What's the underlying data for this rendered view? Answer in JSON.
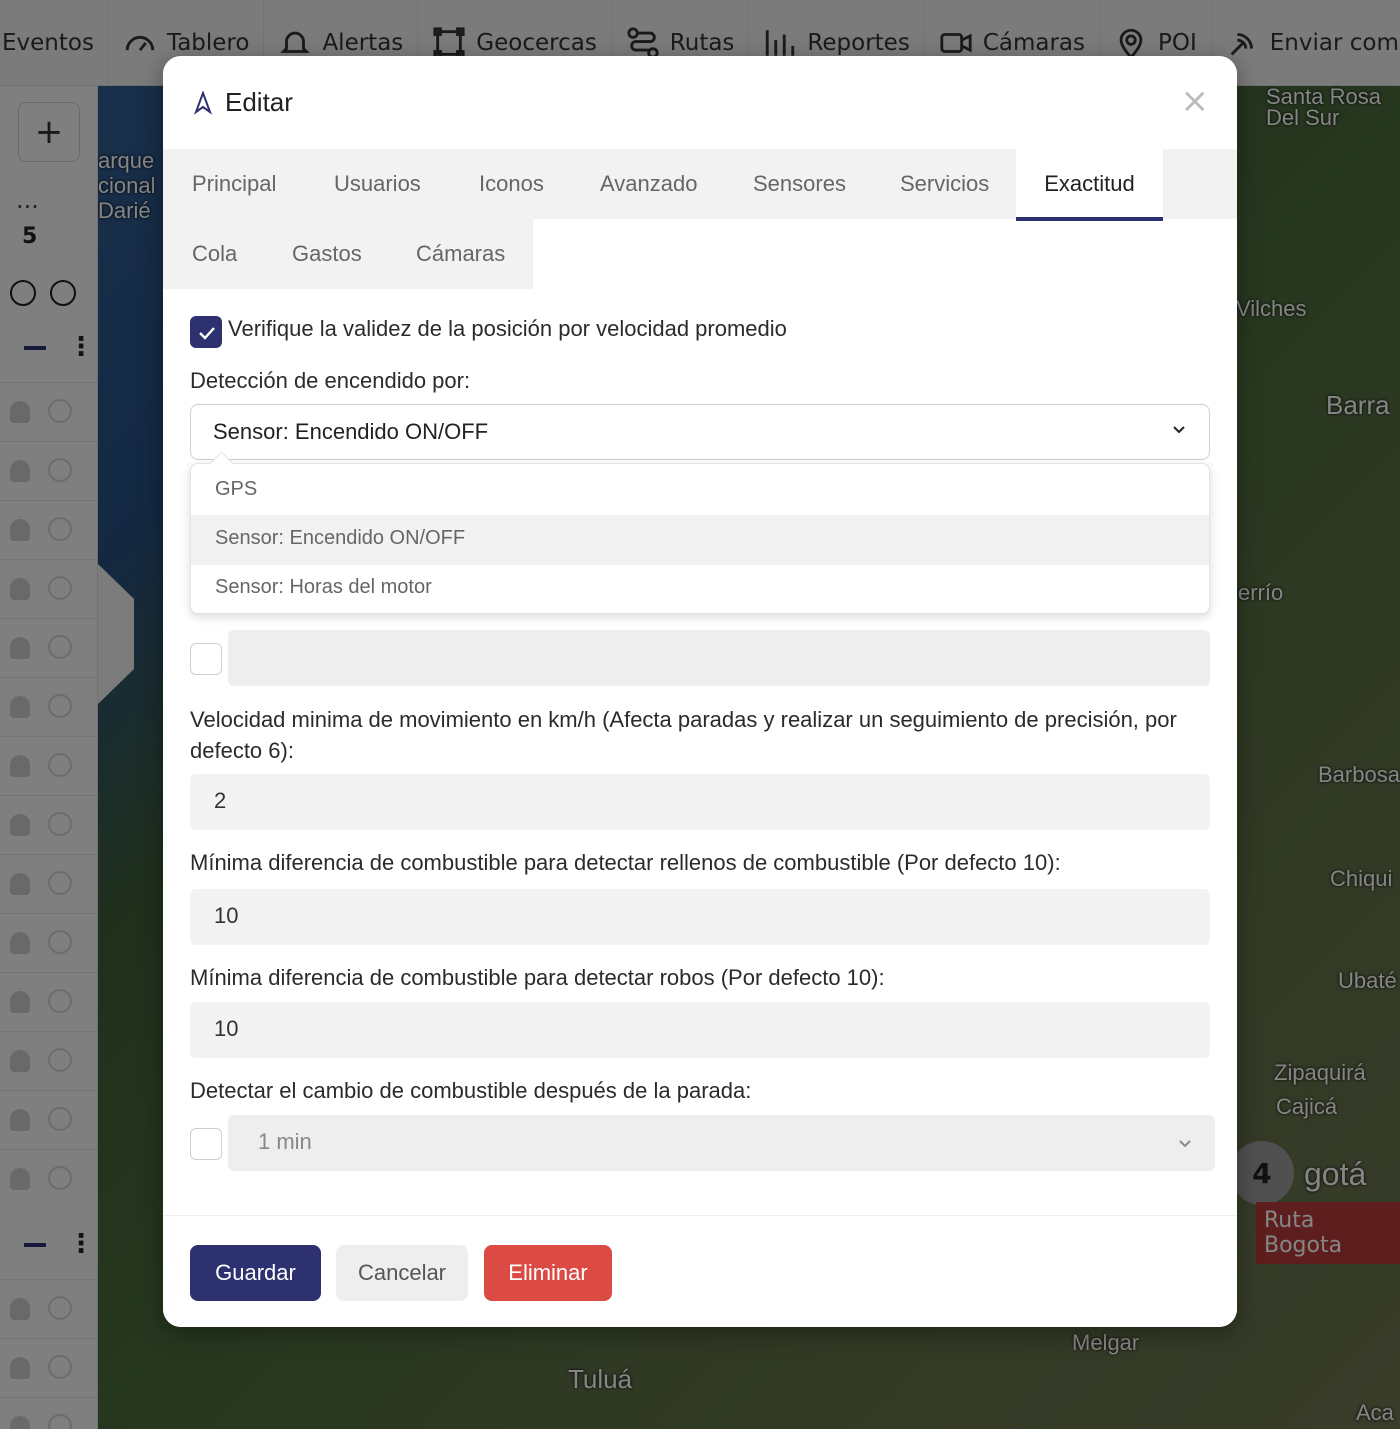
{
  "topnav": {
    "items": [
      {
        "label": "Eventos",
        "icon": "list-icon"
      },
      {
        "label": "Tablero",
        "icon": "gauge-icon"
      },
      {
        "label": "Alertas",
        "icon": "bell-icon"
      },
      {
        "label": "Geocercas",
        "icon": "geofence-icon"
      },
      {
        "label": "Rutas",
        "icon": "route-icon"
      },
      {
        "label": "Reportes",
        "icon": "bar-chart-icon"
      },
      {
        "label": "Cámaras",
        "icon": "video-camera-icon"
      },
      {
        "label": "POI",
        "icon": "map-pin-icon"
      },
      {
        "label": "Enviar comand",
        "icon": "signal-icon"
      }
    ]
  },
  "leftpanel": {
    "add_label": "+",
    "dots": "...",
    "count": "5"
  },
  "map": {
    "labels": [
      "Santa Rosa Del Sur",
      "arque cional Darié",
      "Vilches",
      "Barra",
      "errío",
      "Barbosa",
      "Chiqui",
      "Ubaté",
      "Zipaquirá",
      "Cajicá",
      "gotá",
      "Melgar",
      "Tuluá",
      "Aca"
    ],
    "cluster_count": "4",
    "route_tag": "Ruta Bogota"
  },
  "modal": {
    "title": "Editar",
    "close": "×",
    "tabs_row1": [
      "Principal",
      "Usuarios",
      "Iconos",
      "Avanzado",
      "Sensores",
      "Servicios",
      "Exactitud"
    ],
    "tabs_row2": [
      "Cola",
      "Gastos",
      "Cámaras"
    ],
    "active_tab": "Exactitud",
    "validity_check": {
      "label": "Verifique la validez de la posición por velocidad promedio",
      "checked": true
    },
    "ignition": {
      "label": "Detección de encendido por:",
      "selected": "Sensor: Encendido ON/OFF",
      "options": [
        "GPS",
        "Sensor: Encendido ON/OFF",
        "Sensor: Horas del motor"
      ]
    },
    "hidden_field": {
      "checked": false,
      "value": ""
    },
    "min_speed": {
      "label": "Velocidad minima de movimiento en km/h (Afecta paradas y realizar un seguimiento de precisión, por defecto 6):",
      "value": "2"
    },
    "fuel_fill": {
      "label": "Mínima diferencia de combustible para detectar rellenos de combustible (Por defecto 10):",
      "value": "10"
    },
    "fuel_theft": {
      "label": "Mínima diferencia de combustible para detectar robos (Por defecto 10):",
      "value": "10"
    },
    "fuel_after_stop": {
      "label": "Detectar el cambio de combustible después de la parada:",
      "checked": false,
      "value": "1 min"
    },
    "buttons": {
      "save": "Guardar",
      "cancel": "Cancelar",
      "delete": "Eliminar"
    }
  },
  "colors": {
    "primary": "#2d3170",
    "danger": "#dc4a44"
  }
}
